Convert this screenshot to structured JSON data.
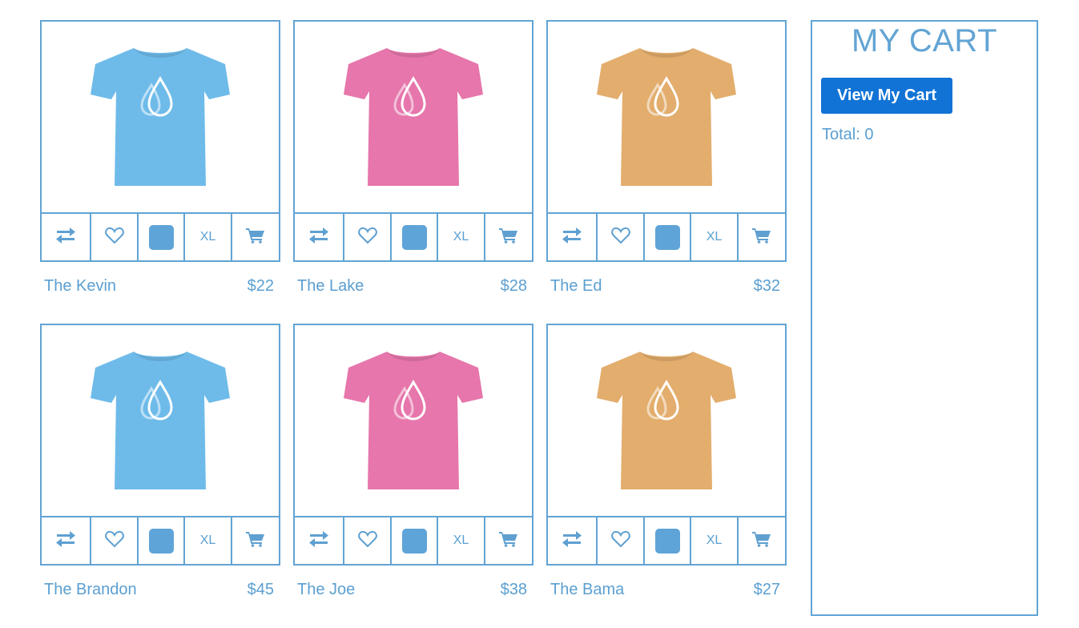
{
  "products": [
    {
      "name": "The Kevin",
      "price": "$22",
      "size": "XL",
      "shirt_color": "#6ebbea",
      "shirt_icon": "tshirt-with-drop-logo"
    },
    {
      "name": "The Lake",
      "price": "$28",
      "size": "XL",
      "shirt_color": "#e676ab",
      "shirt_icon": "tshirt-with-drop-logo"
    },
    {
      "name": "The Ed",
      "price": "$32",
      "size": "XL",
      "shirt_color": "#e3ad6d",
      "shirt_icon": "tshirt-with-drop-logo"
    },
    {
      "name": "The Brandon",
      "price": "$45",
      "size": "XL",
      "shirt_color": "#6ebbea",
      "shirt_icon": "tshirt-with-drop-logo"
    },
    {
      "name": "The Joe",
      "price": "$38",
      "size": "XL",
      "shirt_color": "#e676ab",
      "shirt_icon": "tshirt-with-drop-logo"
    },
    {
      "name": "The Bama",
      "price": "$27",
      "size": "XL",
      "shirt_color": "#e3ad6d",
      "shirt_icon": "tshirt-with-drop-logo"
    }
  ],
  "toolbar_icons": [
    "compare-arrows-icon",
    "heart-icon",
    "color-swatch",
    "size-label",
    "cart-icon"
  ],
  "swatch_color": "#5fa4d8",
  "cart": {
    "title": "MY CART",
    "button_label": "View My Cart",
    "total_text": "Total: 0"
  },
  "colors": {
    "accent": "#62a4d4",
    "button": "#1273d6",
    "text": "#5b9fd1"
  }
}
